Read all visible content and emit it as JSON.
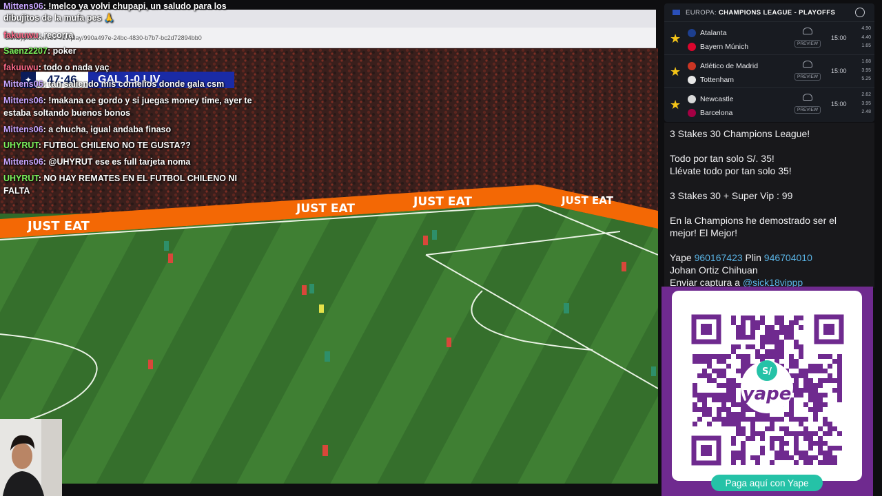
{
  "browser": {
    "url": "disneyplus.com/es-419/play/990a497e-24bc-4830-b7b7-bc2d72894bb0"
  },
  "scoreboard": {
    "clock": "47:46",
    "teams": "GAL 1-0 LIV"
  },
  "chat": [
    {
      "user": "Mittens06",
      "color": "#c7a5ff",
      "msg": "!melco ya volvi chupapi, un saludo para los"
    },
    {
      "user": "",
      "color": "#ffffff",
      "msg": "dibujitos de la mufa pes 🙏"
    },
    {
      "user": "fakuuwu",
      "color": "#ff6b8a",
      "msg": "recorra"
    },
    {
      "user": "Saenz2207",
      "color": "#7cf35d",
      "msg": "poker"
    },
    {
      "user": "fakuuwu",
      "color": "#ff6b8a",
      "msg": "todo o nada yaç"
    },
    {
      "user": "Mittens06",
      "color": "#c7a5ff",
      "msg": "tan saliendo mis cornelios donde gala csm"
    },
    {
      "user": "Mittens06",
      "color": "#c7a5ff",
      "msg": "!makana oe gordo y si juegas money time, ayer te"
    },
    {
      "user": "",
      "color": "#ffffff",
      "msg": "estaba soltando buenos bonos"
    },
    {
      "user": "Mittens06",
      "color": "#c7a5ff",
      "msg": "a chucha, igual andaba finaso"
    },
    {
      "user": "UHYRUT",
      "color": "#7cf35d",
      "msg": "FUTBOL CHILENO NO TE GUSTA??"
    },
    {
      "user": "Mittens06",
      "color": "#c7a5ff",
      "msg": "@UHYRUT ese es full tarjeta noma"
    },
    {
      "user": "UHYRUT",
      "color": "#7cf35d",
      "msg": "NO HAY REMATES EN EL FUTBOL CHILENO NI"
    },
    {
      "user": "",
      "color": "#ffffff",
      "msg": "FALTA"
    }
  ],
  "odds": {
    "region": "EUROPA:",
    "competition": "CHAMPIONS LEAGUE - PLAYOFFS",
    "preview_label": "PREVIEW",
    "matches": [
      {
        "home": "Atalanta",
        "away": "Bayern Múnich",
        "time": "15:00",
        "odds": [
          "4.90",
          "4.40",
          "1.65"
        ],
        "home_color": "#1d3f8f",
        "away_color": "#dc052d"
      },
      {
        "home": "Atlético de Madrid",
        "away": "Tottenham",
        "time": "15:00",
        "odds": [
          "1.68",
          "3.95",
          "5.25"
        ],
        "home_color": "#cb3524",
        "away_color": "#e8e8e8"
      },
      {
        "home": "Newcastle",
        "away": "Barcelona",
        "time": "15:00",
        "odds": [
          "2.62",
          "3.95",
          "2.48"
        ],
        "home_color": "#d8d8d8",
        "away_color": "#a50044"
      }
    ]
  },
  "promo": {
    "l1": "3 Stakes 30 Champions League!",
    "l2": "Todo por tan solo S/. 35!",
    "l3": "Llévate todo por tan solo 35!",
    "l4": "3 Stakes 30 + Super Vip : 99",
    "l5": "En la Champions he demostrado ser el",
    "l6": "mejor! El Mejor!",
    "yape_label": "Yape",
    "yape_number": "960167423",
    "plin_label": "Plin",
    "plin_number": "946704010",
    "name": "Johan Ortiz Chihuan",
    "capture_label": "Enviar captura a",
    "handle": "@sick18vippp"
  },
  "yape": {
    "brand": "yape",
    "currency_badge": "S/",
    "button": "Paga aquí con Yape"
  },
  "pitch_ads": {
    "ad_text": "JUST EAT"
  },
  "colors": {
    "pitch_light": "#3f7f33",
    "pitch_dark": "#2f6a2a",
    "yape_purple": "#6f2a8f",
    "yape_teal": "#25c2a7",
    "ad_orange": "#f36805"
  }
}
